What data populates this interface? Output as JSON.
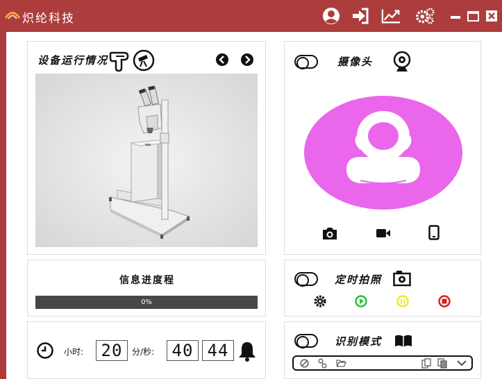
{
  "app": {
    "title": "炽纶科技"
  },
  "device_panel": {
    "title": "设备运行情况"
  },
  "camera_panel": {
    "title": "摄像头"
  },
  "progress_panel": {
    "title": "信息进度程",
    "percent": 0,
    "percent_label": "0%"
  },
  "timer_panel": {
    "hours_label": "小时:",
    "min_sec_label": "分/秒:",
    "hours": "20",
    "minutes": "40",
    "seconds": "44"
  },
  "timed_capture_panel": {
    "title": "定时拍照"
  },
  "recognition_panel": {
    "title": "识别模式"
  },
  "colors": {
    "titlebar": "#ad3d3d",
    "avatar": "#ea66ea",
    "play": "#23c13b",
    "pause": "#f2ea1c",
    "stop": "#d81e1e"
  }
}
